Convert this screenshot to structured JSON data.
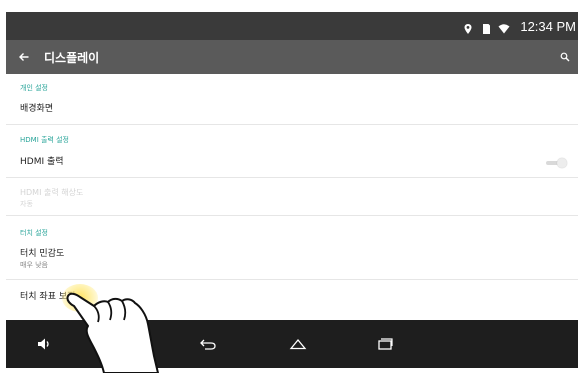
{
  "status_bar": {
    "time": "12:34 PM",
    "icons": [
      "location-icon",
      "sd-card-icon",
      "wifi-icon"
    ]
  },
  "action_bar": {
    "title": "디스플레이",
    "back_icon": "arrow-left-icon",
    "search_icon": "search-icon"
  },
  "sections": {
    "personal": {
      "header": "개인 설정",
      "wallpaper": {
        "title": "배경화면"
      }
    },
    "hdmi": {
      "header": "HDMI 출력 설정",
      "output": {
        "title": "HDMI 출력",
        "toggle_on": false
      },
      "resolution": {
        "title": "HDMI 출력 해상도",
        "subtitle": "자동",
        "enabled": false
      }
    },
    "touch": {
      "header": "터치 설정",
      "sensitivity": {
        "title": "터치 민감도",
        "subtitle": "매우 낮음"
      },
      "calibration": {
        "title": "터치 좌표 보정"
      }
    }
  },
  "nav_bar": {
    "buttons": [
      "volume-icon",
      "back-icon",
      "home-icon",
      "recents-icon"
    ]
  },
  "colors": {
    "status_bar_bg": "#3a3a3a",
    "action_bar_bg": "#5a5a5a",
    "section_header": "#2aa59a",
    "nav_bar_bg": "#1e1e1e"
  }
}
